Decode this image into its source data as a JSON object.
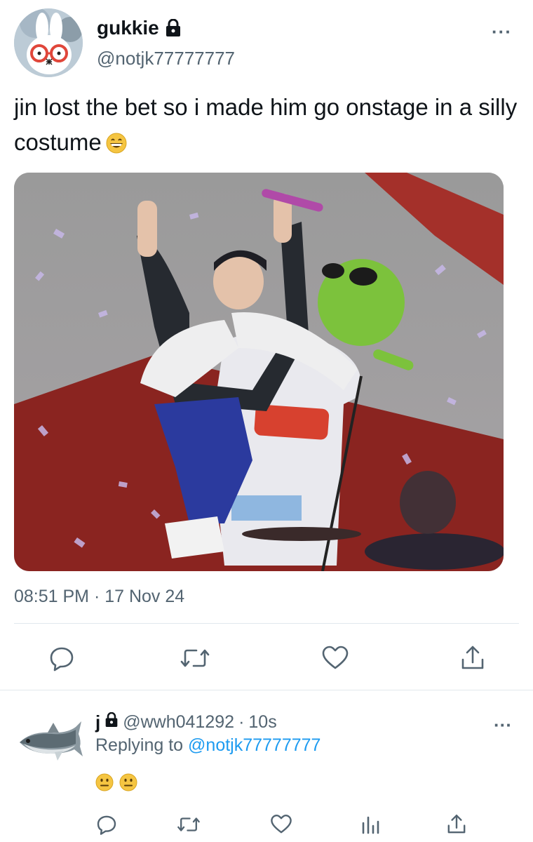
{
  "tweet": {
    "display_name": "gukkie",
    "handle": "@notjk77777777",
    "text": "jin lost the bet so i made him go onstage in a silly costume",
    "timestamp": "08:51 PM · 17 Nov 24",
    "more_label": "···",
    "avatar_icon": "bunny-avatar-icon",
    "lock_icon": "lock-icon",
    "text_emoji": "grinning-face-icon"
  },
  "actions": {
    "reply_icon": "reply-icon",
    "retweet_icon": "retweet-icon",
    "like_icon": "heart-icon",
    "share_icon": "share-icon",
    "views_icon": "views-icon"
  },
  "reply": {
    "display_name": "j",
    "handle": "@wwh041292",
    "separator": "·",
    "time": "10s",
    "replying_prefix": "Replying to",
    "replying_to": "@notjk77777777",
    "more_label": "···",
    "avatar_icon": "fish-avatar-icon",
    "emojis": [
      "neutral-face-icon",
      "neutral-face-icon"
    ]
  },
  "colors": {
    "text_primary": "#0f1419",
    "text_secondary": "#536471",
    "accent": "#1d9bf0",
    "divider": "#e1e8ed"
  }
}
